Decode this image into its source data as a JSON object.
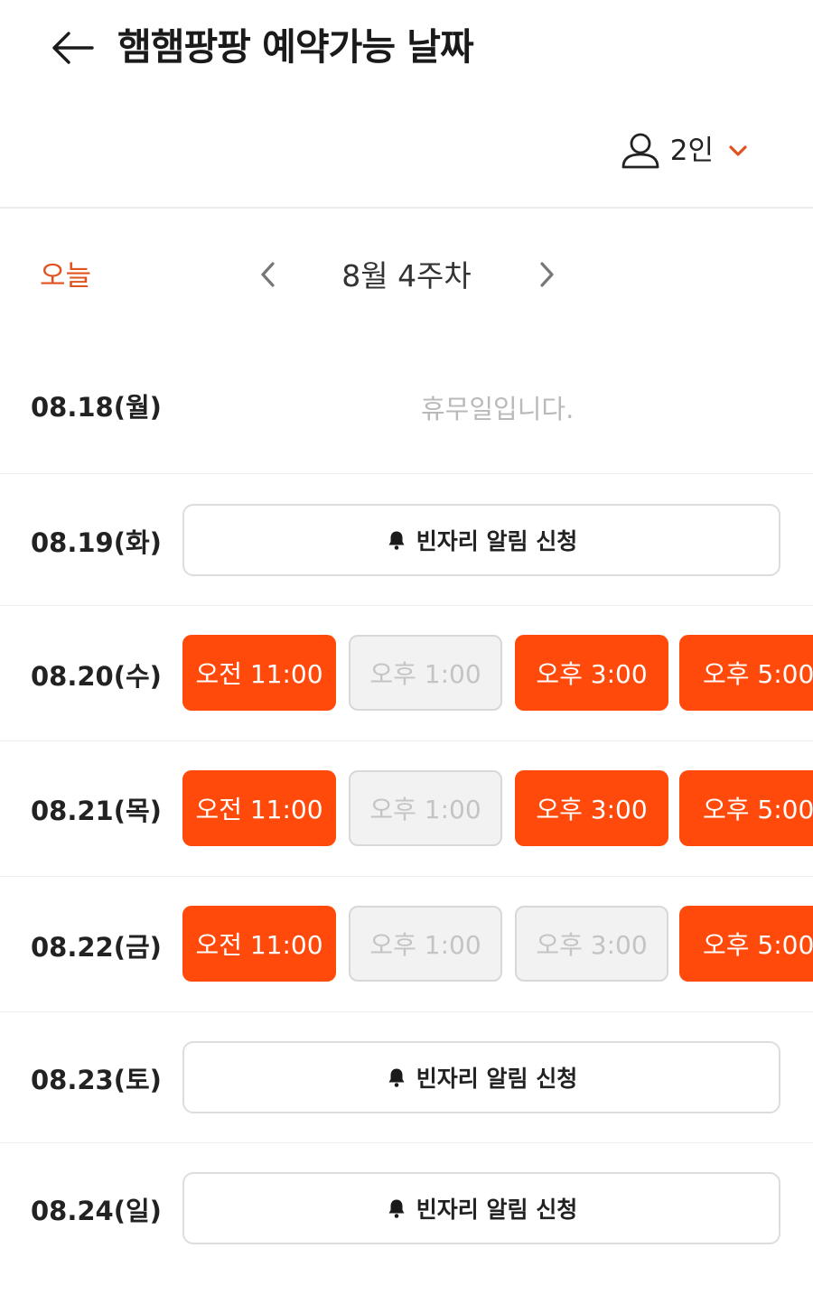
{
  "header": {
    "title": "햄햄팡팡 예약가능 날짜",
    "back_icon": "arrow-left-icon"
  },
  "party": {
    "label": "2인",
    "person_icon": "person-icon",
    "chevron_icon": "chevron-down-icon"
  },
  "week": {
    "today_label": "오늘",
    "label": "8월 4주차"
  },
  "colors": {
    "accent": "#ff4a0b",
    "accent_text": "#e0531f",
    "disabled_bg": "#f2f2f2",
    "disabled_text": "#c4c4c4"
  },
  "days": [
    {
      "date": "08.18(월)",
      "closed_text": "휴무일입니다."
    },
    {
      "date": "08.19(화)",
      "alert_label": "빈자리 알림 신청"
    },
    {
      "date": "08.20(수)",
      "slots": [
        {
          "label": "오전 11:00",
          "available": true
        },
        {
          "label": "오후 1:00",
          "available": false
        },
        {
          "label": "오후 3:00",
          "available": true
        },
        {
          "label": "오후 5:00",
          "available": true
        }
      ]
    },
    {
      "date": "08.21(목)",
      "slots": [
        {
          "label": "오전 11:00",
          "available": true
        },
        {
          "label": "오후 1:00",
          "available": false
        },
        {
          "label": "오후 3:00",
          "available": true
        },
        {
          "label": "오후 5:00",
          "available": true
        }
      ]
    },
    {
      "date": "08.22(금)",
      "slots": [
        {
          "label": "오전 11:00",
          "available": true
        },
        {
          "label": "오후 1:00",
          "available": false
        },
        {
          "label": "오후 3:00",
          "available": false
        },
        {
          "label": "오후 5:00",
          "available": true
        }
      ]
    },
    {
      "date": "08.23(토)",
      "alert_label": "빈자리 알림 신청"
    },
    {
      "date": "08.24(일)",
      "alert_label": "빈자리 알림 신청"
    }
  ]
}
